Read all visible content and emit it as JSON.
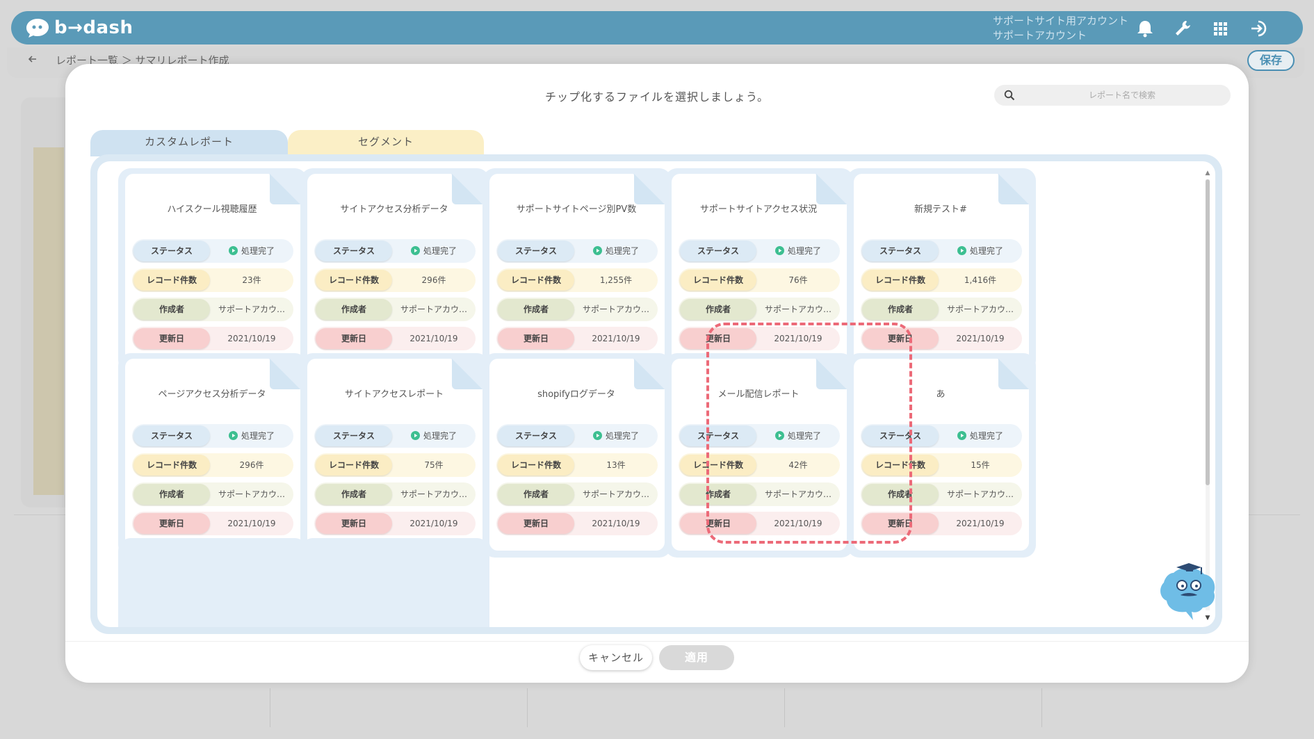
{
  "header": {
    "logo_text": "b→dash",
    "account_line1": "サポートサイト用アカウント",
    "account_line2": "サポートアカウント",
    "icons": [
      "bell-icon",
      "wrench-icon",
      "apps-grid-icon",
      "logout-icon"
    ],
    "background_color": "#5a9ab8"
  },
  "subbar": {
    "breadcrumb": "レポート一覧 ＞ サマリレポート作成",
    "save_label": "保存"
  },
  "modal": {
    "title": "チップ化するファイルを選択しましょう。",
    "search_placeholder": "レポート名で検索",
    "tabs": [
      {
        "label": "カスタムレポート",
        "active": true
      },
      {
        "label": "セグメント",
        "active": false
      }
    ],
    "row_labels": {
      "status": "ステータス",
      "records": "レコード件数",
      "creator": "作成者",
      "updated": "更新日"
    },
    "cards": [
      {
        "title": "ハイスクール視聴履歴",
        "status": "処理完了",
        "records": "23件",
        "creator": "サポートアカウ…",
        "updated": "2021/10/19",
        "selected": false
      },
      {
        "title": "サイトアクセス分析データ",
        "status": "処理完了",
        "records": "296件",
        "creator": "サポートアカウ…",
        "updated": "2021/10/19",
        "selected": false
      },
      {
        "title": "サポートサイトページ別PV数",
        "status": "処理完了",
        "records": "1,255件",
        "creator": "サポートアカウ…",
        "updated": "2021/10/19",
        "selected": false
      },
      {
        "title": "サポートサイトアクセス状況",
        "status": "処理完了",
        "records": "76件",
        "creator": "サポートアカウ…",
        "updated": "2021/10/19",
        "selected": false
      },
      {
        "title": "新規テスト#",
        "status": "処理完了",
        "records": "1,416件",
        "creator": "サポートアカウ…",
        "updated": "2021/10/19",
        "selected": false
      },
      {
        "title": "ページアクセス分析データ",
        "status": "処理完了",
        "records": "296件",
        "creator": "サポートアカウ…",
        "updated": "2021/10/19",
        "selected": false
      },
      {
        "title": "サイトアクセスレポート",
        "status": "処理完了",
        "records": "75件",
        "creator": "サポートアカウ…",
        "updated": "2021/10/19",
        "selected": false
      },
      {
        "title": "shopifyログデータ",
        "status": "処理完了",
        "records": "13件",
        "creator": "サポートアカウ…",
        "updated": "2021/10/19",
        "selected": false
      },
      {
        "title": "メール配信レポート",
        "status": "処理完了",
        "records": "42件",
        "creator": "サポートアカウ…",
        "updated": "2021/10/19",
        "selected": true
      },
      {
        "title": "あ",
        "status": "処理完了",
        "records": "15件",
        "creator": "サポートアカウ…",
        "updated": "2021/10/19",
        "selected": false
      }
    ],
    "cancel_label": "キャンセル",
    "apply_label": "適用",
    "apply_enabled": false,
    "accent_color": "#ec6a78",
    "status_icon_color": "#3dbf91"
  }
}
